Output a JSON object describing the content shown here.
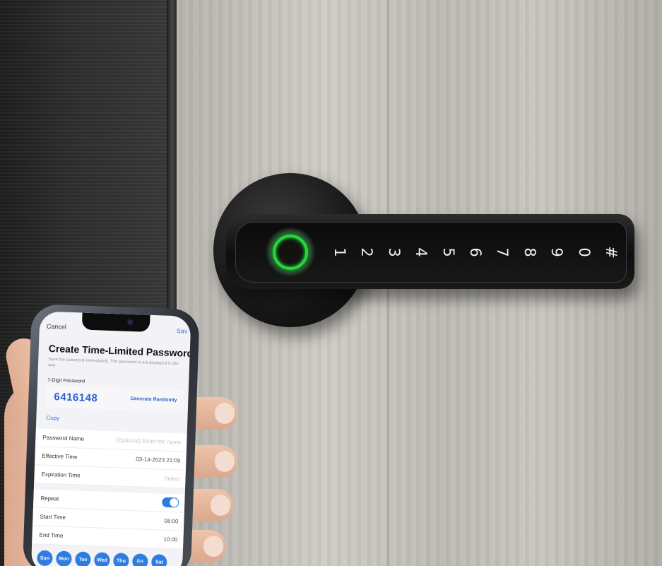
{
  "lock": {
    "keypad": [
      "1",
      "2",
      "3",
      "4",
      "5",
      "6",
      "7",
      "8",
      "9",
      "0",
      "#"
    ]
  },
  "app": {
    "cancel_label": "Cancel",
    "save_label": "Sav",
    "title": "Create Time-Limited Password",
    "description": "Save the password immediately. The password is not displayed in the app.",
    "password_label": "7-Digit Password",
    "password_value": "6416148",
    "generate_label": "Generate Randomly",
    "copy_label": "Copy",
    "password_name": {
      "label": "Password Name",
      "placeholder": "(Optional) Enter the name"
    },
    "effective_time": {
      "label": "Effective Time",
      "value": "03-14-2023 21:09"
    },
    "expiration_time": {
      "label": "Expiration Time",
      "value": "Select"
    },
    "repeat": {
      "label": "Repeat",
      "enabled": true
    },
    "start_time": {
      "label": "Start Time",
      "value": "08:00"
    },
    "end_time": {
      "label": "End Time",
      "value": "10:00"
    },
    "days": [
      "Sun",
      "Mon",
      "Tue",
      "Wed",
      "Thu",
      "Fri",
      "Sat"
    ],
    "accent_color": "#2f7de1"
  }
}
